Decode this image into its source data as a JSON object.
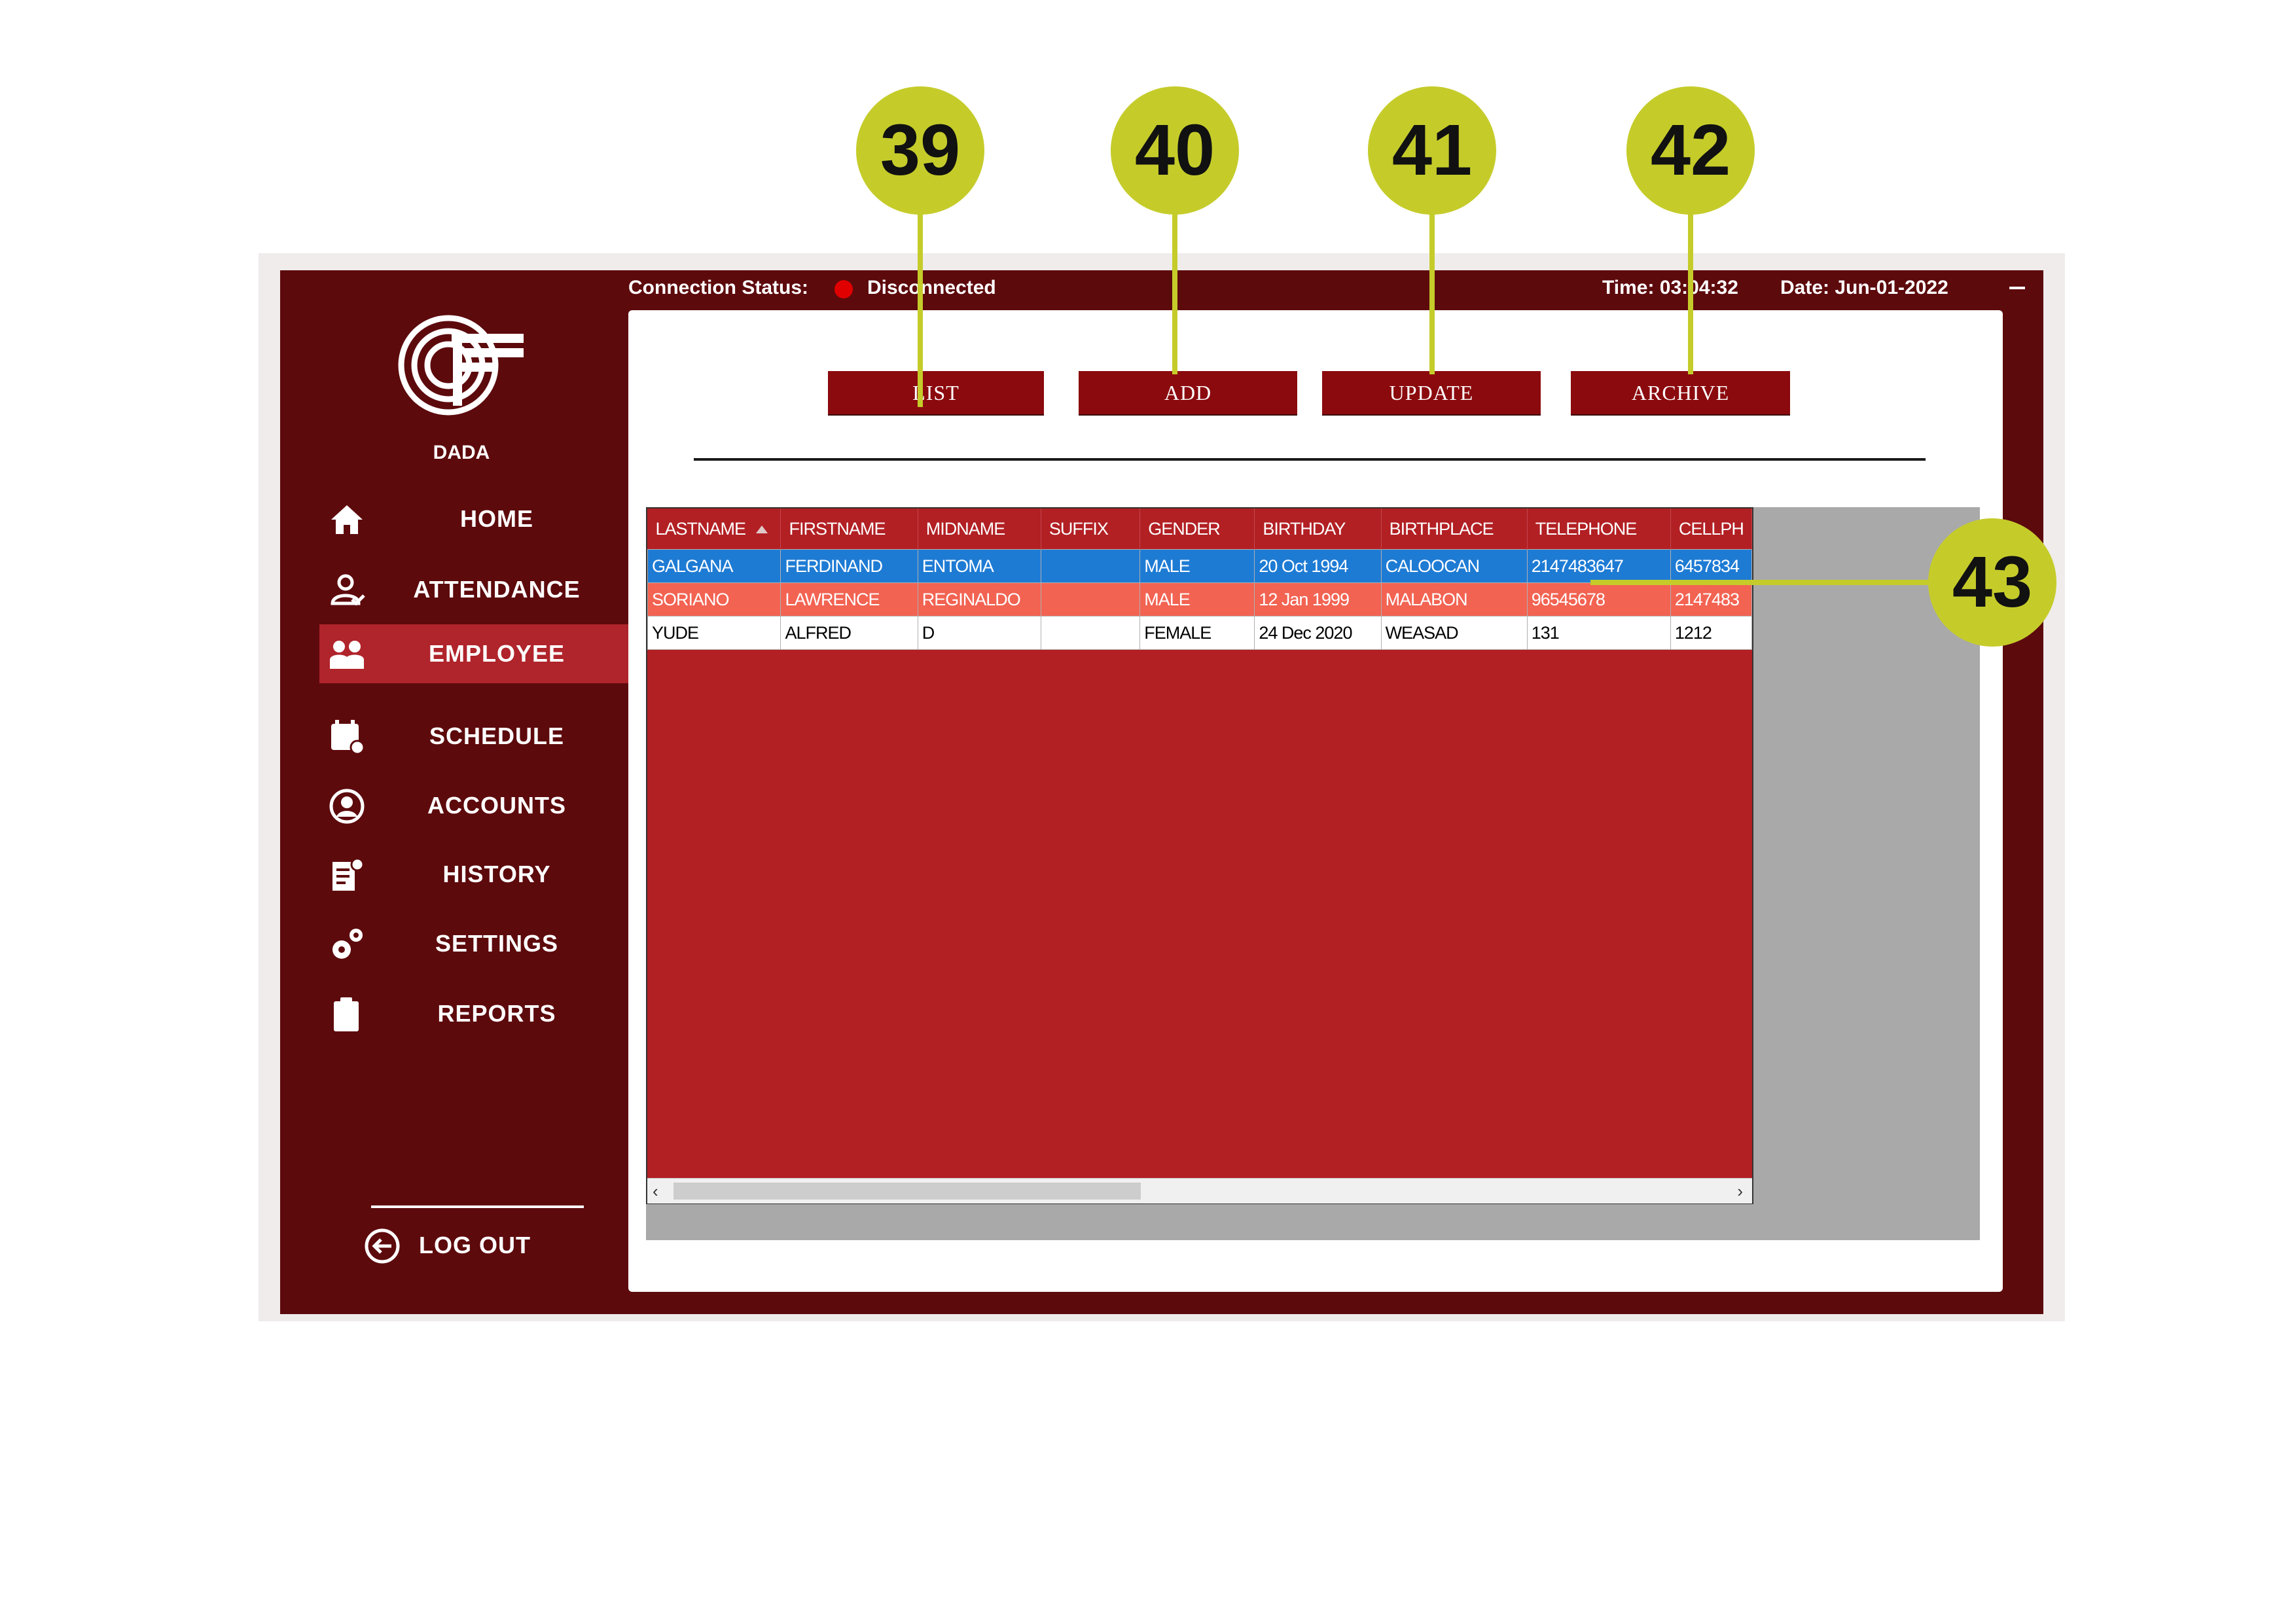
{
  "app": {
    "brand": "DADA"
  },
  "topbar": {
    "connection_label": "Connection Status:",
    "connection_value": "Disconnected",
    "time_label": "Time: 03:04:32",
    "date_label": "Date: Jun-01-2022"
  },
  "sidebar": {
    "items": [
      {
        "label": "HOME",
        "icon": "home-icon"
      },
      {
        "label": "ATTENDANCE",
        "icon": "user-check-icon"
      },
      {
        "label": "EMPLOYEE",
        "icon": "employees-icon",
        "active": true
      },
      {
        "label": "SCHEDULE",
        "icon": "calendar-icon"
      },
      {
        "label": "ACCOUNTS",
        "icon": "user-circle-icon"
      },
      {
        "label": "HISTORY",
        "icon": "document-icon"
      },
      {
        "label": "SETTINGS",
        "icon": "gears-icon"
      },
      {
        "label": "REPORTS",
        "icon": "clipboard-icon"
      }
    ],
    "logout_label": "LOG OUT"
  },
  "actions": {
    "list": "LIST",
    "add": "ADD",
    "update": "UPDATE",
    "archive": "ARCHIVE"
  },
  "table": {
    "columns": [
      "LASTNAME",
      "FIRSTNAME",
      "MIDNAME",
      "SUFFIX",
      "GENDER",
      "BIRTHDAY",
      "BIRTHPLACE",
      "TELEPHONE",
      "CELLPH"
    ],
    "rows": [
      [
        "GALGANA",
        "FERDINAND",
        "ENTOMA",
        "",
        "MALE",
        "20 Oct 1994",
        "CALOOCAN",
        "2147483647",
        "6457834"
      ],
      [
        "SORIANO",
        "LAWRENCE",
        "REGINALDO",
        "",
        "MALE",
        "12 Jan 1999",
        "MALABON",
        "96545678",
        "2147483"
      ],
      [
        "YUDE",
        "ALFRED",
        "D",
        "",
        "FEMALE",
        "24 Dec 2020",
        "WEASAD",
        "131",
        "1212"
      ]
    ]
  },
  "callouts": [
    "39",
    "40",
    "41",
    "42",
    "43"
  ],
  "colors": {
    "sidebar_bg": "#5d0a0d",
    "active_item": "#b0242b",
    "button_bg": "#8b0a0e",
    "grid_red": "#b22024",
    "selected_row": "#1e7bd4",
    "alt_row": "#f26352",
    "callout": "#c5cc2a"
  }
}
